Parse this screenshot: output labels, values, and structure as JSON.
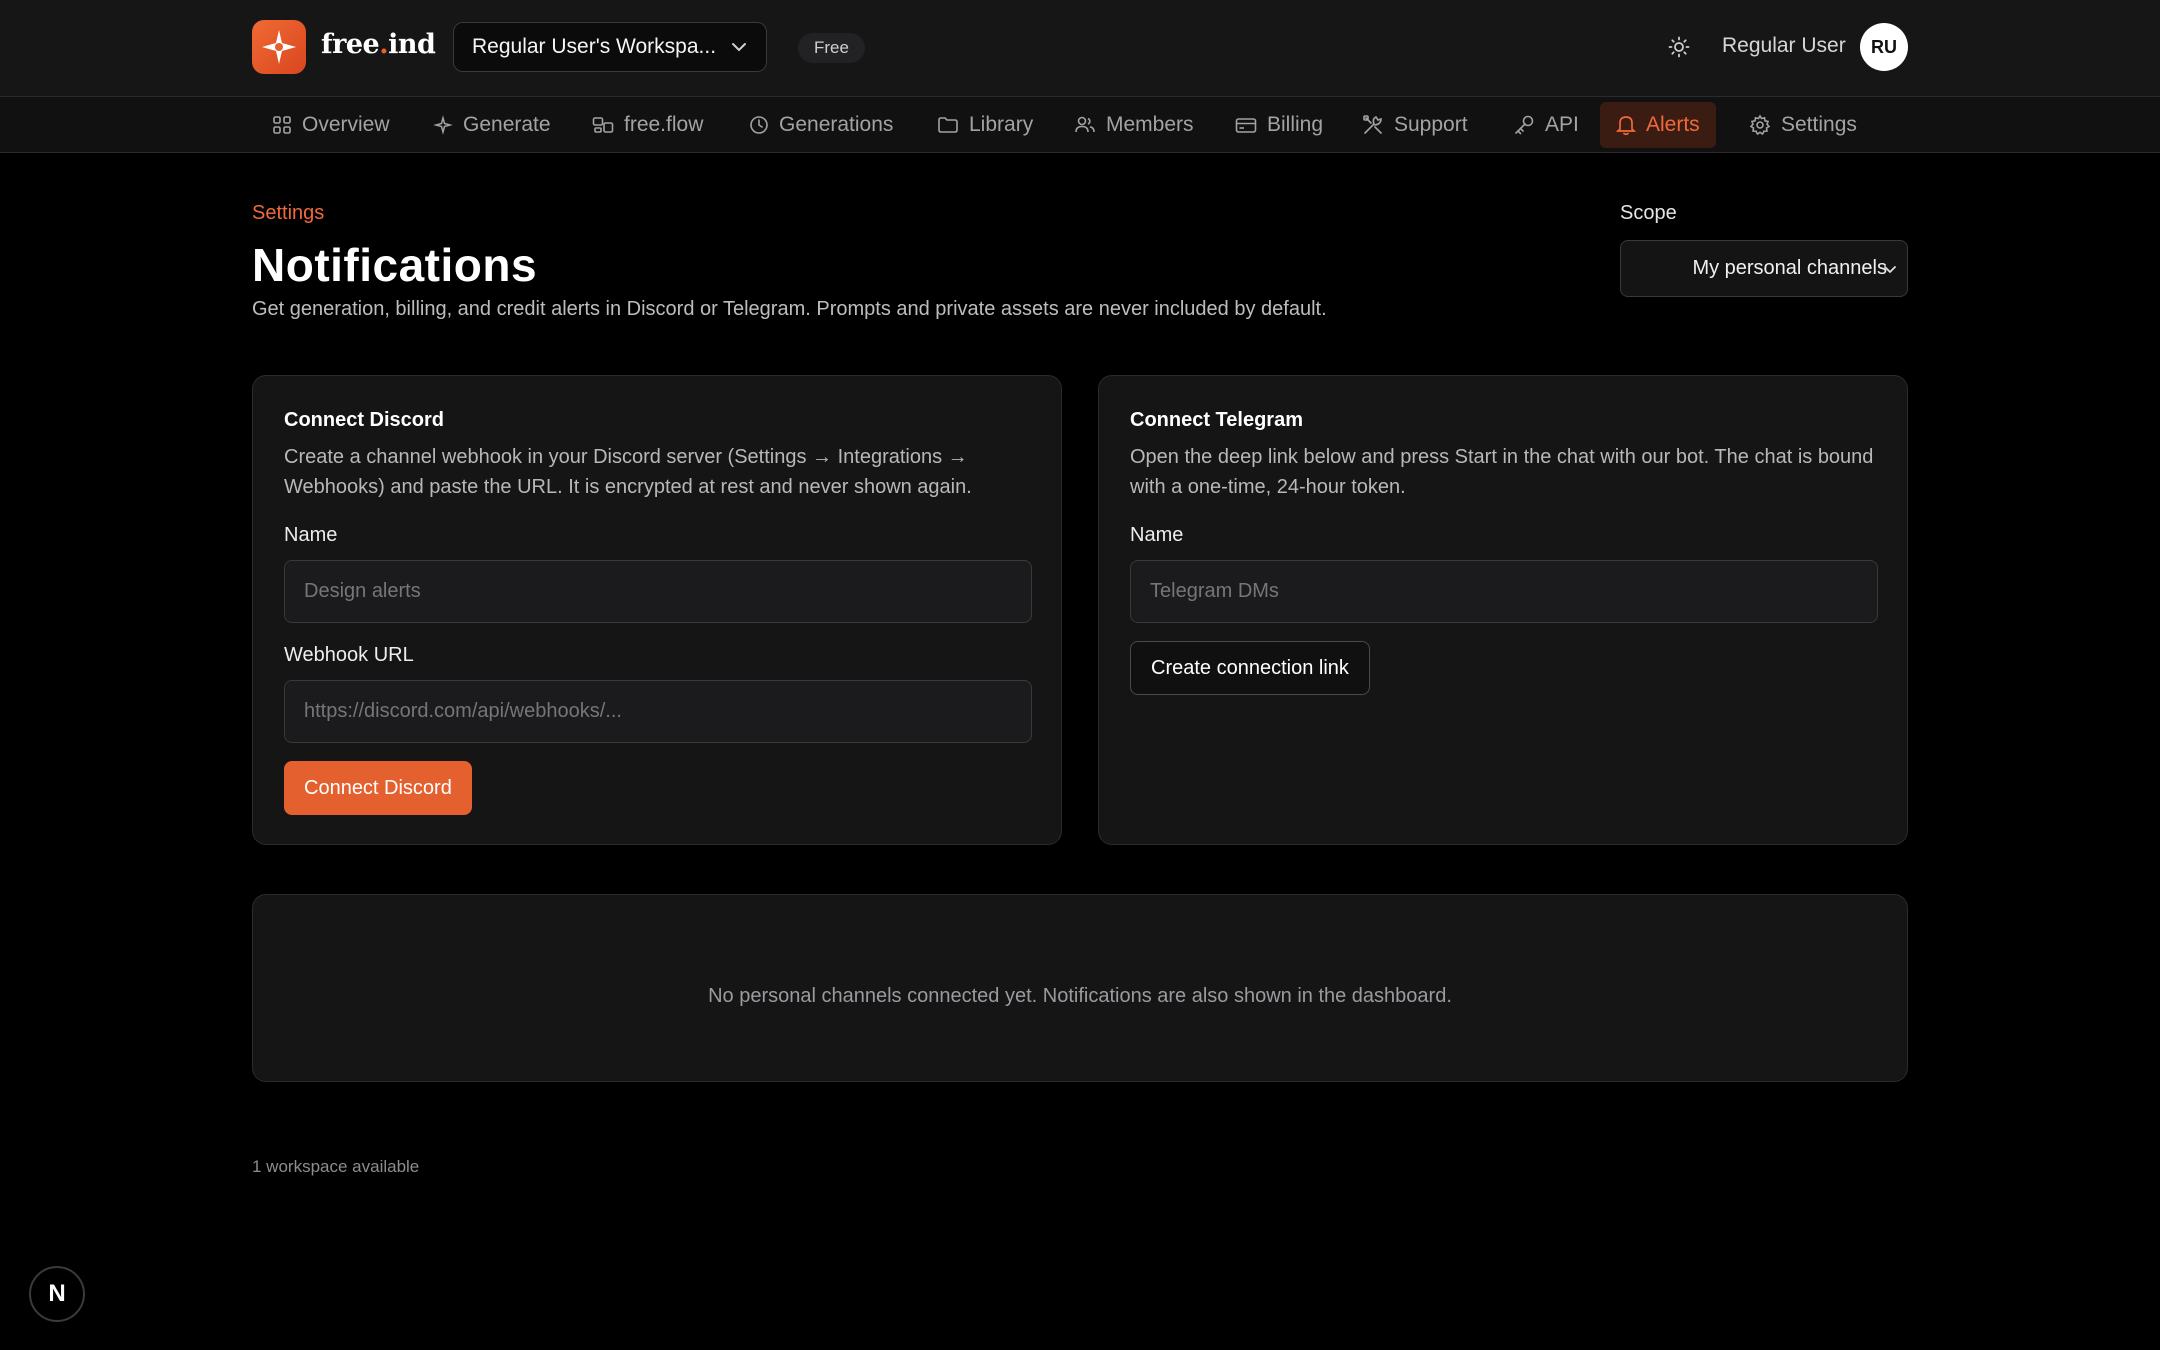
{
  "header": {
    "logo_text_a": "free",
    "logo_text_dot": ".",
    "logo_text_b": "ind",
    "workspace_label": "Regular User's Workspa...",
    "plan_badge": "Free",
    "user_name": "Regular User",
    "avatar_initials": "RU"
  },
  "nav": {
    "items": [
      {
        "label": "Overview",
        "icon": "grid-icon"
      },
      {
        "label": "Generate",
        "icon": "sparkle-icon"
      },
      {
        "label": "free.flow",
        "icon": "flow-icon"
      },
      {
        "label": "Generations",
        "icon": "clock-icon"
      },
      {
        "label": "Library",
        "icon": "folder-icon"
      },
      {
        "label": "Members",
        "icon": "users-icon"
      },
      {
        "label": "Billing",
        "icon": "card-icon"
      },
      {
        "label": "Support",
        "icon": "tools-icon"
      },
      {
        "label": "API",
        "icon": "key-icon"
      },
      {
        "label": "Alerts",
        "icon": "bell-icon",
        "active": true
      },
      {
        "label": "Settings",
        "icon": "gear-icon"
      }
    ]
  },
  "page": {
    "breadcrumb": "Settings",
    "title": "Notifications",
    "description": "Get generation, billing, and credit alerts in Discord or Telegram. Prompts and private assets are never included by default.",
    "scope_label": "Scope",
    "scope_value": "My personal channels"
  },
  "discord": {
    "title": "Connect Discord",
    "description": "Create a channel webhook in your Discord server (Settings → Integrations → Webhooks) and paste the URL. It is encrypted at rest and never shown again.",
    "name_label": "Name",
    "name_placeholder": "Design alerts",
    "url_label": "Webhook URL",
    "url_placeholder": "https://discord.com/api/webhooks/...",
    "button": "Connect Discord"
  },
  "telegram": {
    "title": "Connect Telegram",
    "description": "Open the deep link below and press Start in the chat with our bot. The chat is bound with a one-time, 24-hour token.",
    "name_label": "Name",
    "name_placeholder": "Telegram DMs",
    "button": "Create connection link"
  },
  "channels": {
    "empty_message": "No personal channels connected yet. Notifications are also shown in the dashboard."
  },
  "footer": {
    "workspace_count": "1 workspace available",
    "dev_badge": "N"
  },
  "colors": {
    "accent": "#e4602e",
    "background": "#000000",
    "surface": "#151516"
  }
}
